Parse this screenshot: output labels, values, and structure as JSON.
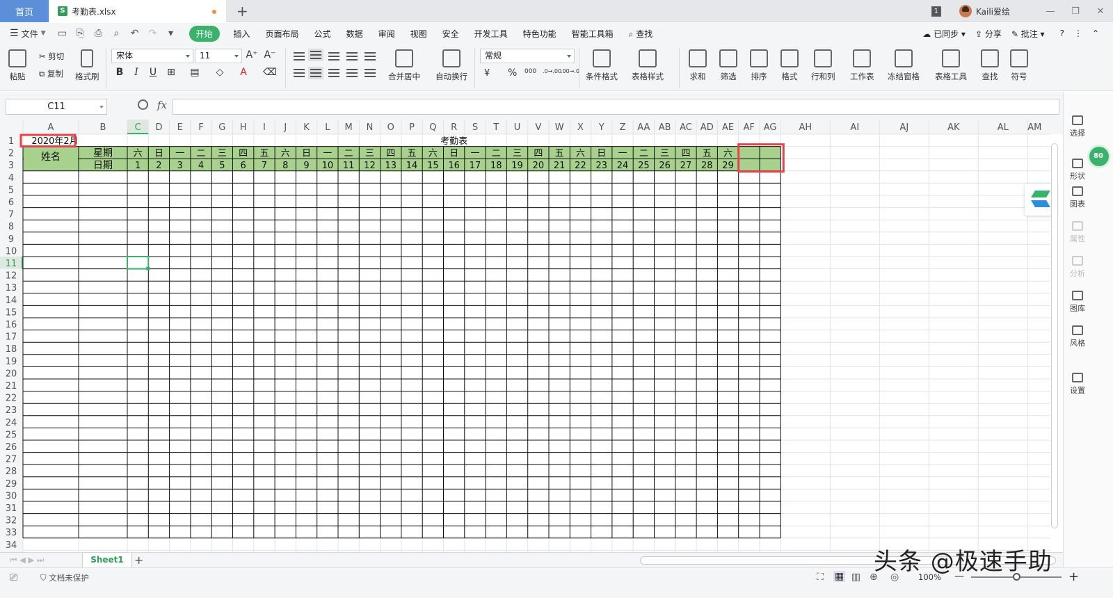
{
  "titlebar": {
    "home_tab": "首页",
    "file_tab": "考勤表.xlsx",
    "file_icon": "S",
    "badge": "1",
    "user": "Kaili爱绘",
    "minimize": "—",
    "restore": "❐",
    "close": "✕",
    "new_tab": "+"
  },
  "menubar": {
    "file": "文件",
    "tabs": [
      "开始",
      "插入",
      "页面布局",
      "公式",
      "数据",
      "审阅",
      "视图",
      "安全",
      "开发工具",
      "特色功能",
      "智能工具箱"
    ],
    "search": "查找",
    "sync": "已同步",
    "share": "分享",
    "comment": "批注",
    "help": "?"
  },
  "ribbon": {
    "paste": "粘贴",
    "cut": "剪切",
    "copy": "复制",
    "format_painter": "格式刷",
    "font": "宋体",
    "size": "11",
    "merge": "合并居中",
    "wrap": "自动换行",
    "number_format": "常规",
    "conditional": "条件格式",
    "table_style": "表格样式",
    "sum": "求和",
    "filter": "筛选",
    "sort": "排序",
    "format": "格式",
    "rowcol": "行和列",
    "worksheet": "工作表",
    "freeze": "冻结窗格",
    "table_tools": "表格工具",
    "find": "查找",
    "symbol": "符号",
    "currency": "¥",
    "percent": "%",
    "thousands": "000",
    "dec_inc": ".0→.00",
    "dec_dec": ".00→.0"
  },
  "formula": {
    "cell_ref": "C11",
    "fx": "fx",
    "value": ""
  },
  "sheet": {
    "columns": [
      "A",
      "B",
      "C",
      "D",
      "E",
      "F",
      "G",
      "H",
      "I",
      "J",
      "K",
      "L",
      "M",
      "N",
      "O",
      "P",
      "Q",
      "R",
      "S",
      "T",
      "U",
      "V",
      "W",
      "X",
      "Y",
      "Z",
      "AA",
      "AB",
      "AC",
      "AD",
      "AE",
      "AF",
      "AG",
      "AH",
      "AI",
      "AJ",
      "AK",
      "AL",
      "AM"
    ],
    "rows": [
      "1",
      "2",
      "3",
      "4",
      "5",
      "6",
      "7",
      "8",
      "9",
      "10",
      "11",
      "12",
      "13",
      "14",
      "15",
      "16",
      "17",
      "18",
      "19",
      "20",
      "21",
      "22",
      "23",
      "24",
      "25",
      "26",
      "27",
      "28",
      "29",
      "30",
      "31",
      "32",
      "33",
      "34"
    ],
    "a1": "2020年2月",
    "title": "考勤表",
    "name_header": "姓名",
    "weekday_header": "星期",
    "date_header": "日期",
    "weekdays": [
      "六",
      "日",
      "一",
      "二",
      "三",
      "四",
      "五",
      "六",
      "日",
      "一",
      "二",
      "三",
      "四",
      "五",
      "六",
      "日",
      "一",
      "二",
      "三",
      "四",
      "五",
      "六",
      "日",
      "一",
      "二",
      "三",
      "四",
      "五",
      "六",
      "",
      ""
    ],
    "dates": [
      "1",
      "2",
      "3",
      "4",
      "5",
      "6",
      "7",
      "8",
      "9",
      "10",
      "11",
      "12",
      "13",
      "14",
      "15",
      "16",
      "17",
      "18",
      "19",
      "20",
      "21",
      "22",
      "23",
      "24",
      "25",
      "26",
      "27",
      "28",
      "29",
      "",
      ""
    ],
    "header_fill": "#a9d18e",
    "highlight": "#e8414b",
    "selected": "#3ab26b"
  },
  "side": {
    "items": [
      "选择",
      "形状",
      "图表",
      "属性",
      "分析",
      "图库",
      "风格",
      "设置"
    ],
    "bubble": "80"
  },
  "bottom": {
    "sheet_tab": "Sheet1",
    "add": "+"
  },
  "status": {
    "protect": "文档未保护",
    "zoom": "100%",
    "minus": "—",
    "plus": "+"
  },
  "watermark": "头条 @极速手助"
}
